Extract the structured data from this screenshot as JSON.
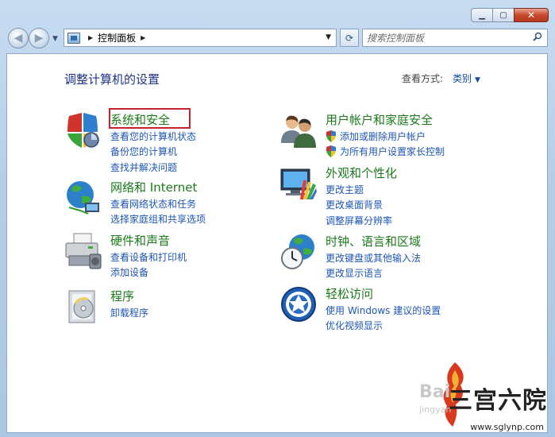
{
  "window": {
    "minimize": "▁",
    "maximize": "▢",
    "close": "✕"
  },
  "nav": {
    "address_path": "控制面板",
    "search_placeholder": "搜索控制面板"
  },
  "main": {
    "heading": "调整计算机的设置",
    "view_by_label": "查看方式:",
    "view_by_value": "类别"
  },
  "categories": {
    "system_security": {
      "title": "系统和安全",
      "links": [
        "查看您的计算机状态",
        "备份您的计算机",
        "查找并解决问题"
      ]
    },
    "network": {
      "title": "网络和 Internet",
      "links": [
        "查看网络状态和任务",
        "选择家庭组和共享选项"
      ]
    },
    "hardware": {
      "title": "硬件和声音",
      "links": [
        "查看设备和打印机",
        "添加设备"
      ]
    },
    "programs": {
      "title": "程序",
      "links": [
        "卸载程序"
      ]
    },
    "user_accounts": {
      "title": "用户帐户和家庭安全",
      "links": [
        "添加或删除用户帐户",
        "为所有用户设置家长控制"
      ]
    },
    "appearance": {
      "title": "外观和个性化",
      "links": [
        "更改主题",
        "更改桌面背景",
        "调整屏幕分辨率"
      ]
    },
    "clock": {
      "title": "时钟、语言和区域",
      "links": [
        "更改键盘或其他输入法",
        "更改显示语言"
      ]
    },
    "ease": {
      "title": "轻松访问",
      "links": [
        "使用 Windows 建议的设置",
        "优化视频显示"
      ]
    }
  },
  "watermark": {
    "brand": "三宫六院",
    "url": "www.sglynp.com",
    "baidu": "Bai",
    "jingyan": "jingyan"
  }
}
